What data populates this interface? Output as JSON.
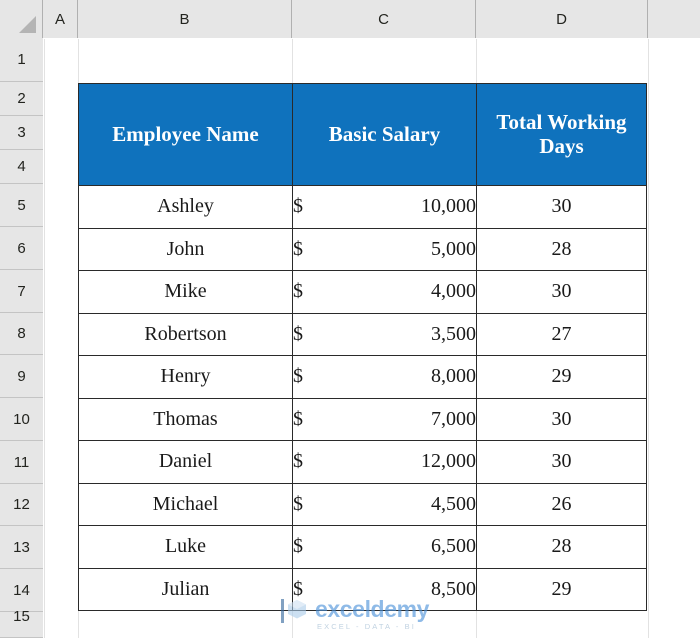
{
  "spreadsheet": {
    "column_headers": [
      "A",
      "B",
      "C",
      "D"
    ],
    "row_headers": [
      "1",
      "2",
      "3",
      "4",
      "5",
      "6",
      "7",
      "8",
      "9",
      "10",
      "11",
      "12",
      "13",
      "14",
      "15"
    ],
    "select_all_icon": "select-all-triangle-icon",
    "header_fill_color": "#0f72bd",
    "header_text_color": "#ffffff",
    "grid_line_color": "#e2e2e2",
    "border_color": "#2a2a2a"
  },
  "table": {
    "columns": [
      "Employee Name",
      "Basic Salary",
      "Total Working Days"
    ],
    "currency_symbol": "$",
    "rows": [
      {
        "name": "Ashley",
        "salary": "10,000",
        "days": "30"
      },
      {
        "name": "John",
        "salary": "5,000",
        "days": "28"
      },
      {
        "name": "Mike",
        "salary": "4,000",
        "days": "30"
      },
      {
        "name": "Robertson",
        "salary": "3,500",
        "days": "27"
      },
      {
        "name": "Henry",
        "salary": "8,000",
        "days": "29"
      },
      {
        "name": "Thomas",
        "salary": "7,000",
        "days": "30"
      },
      {
        "name": "Daniel",
        "salary": "12,000",
        "days": "30"
      },
      {
        "name": "Michael",
        "salary": "4,500",
        "days": "26"
      },
      {
        "name": "Luke",
        "salary": "6,500",
        "days": "28"
      },
      {
        "name": "Julian",
        "salary": "8,500",
        "days": "29"
      }
    ]
  },
  "watermark": {
    "title": "exceldemy",
    "subtitle": "EXCEL - DATA - BI",
    "logo_icon": "exceldemy-cube-logo-icon",
    "accent_color": "#4a90d9"
  }
}
